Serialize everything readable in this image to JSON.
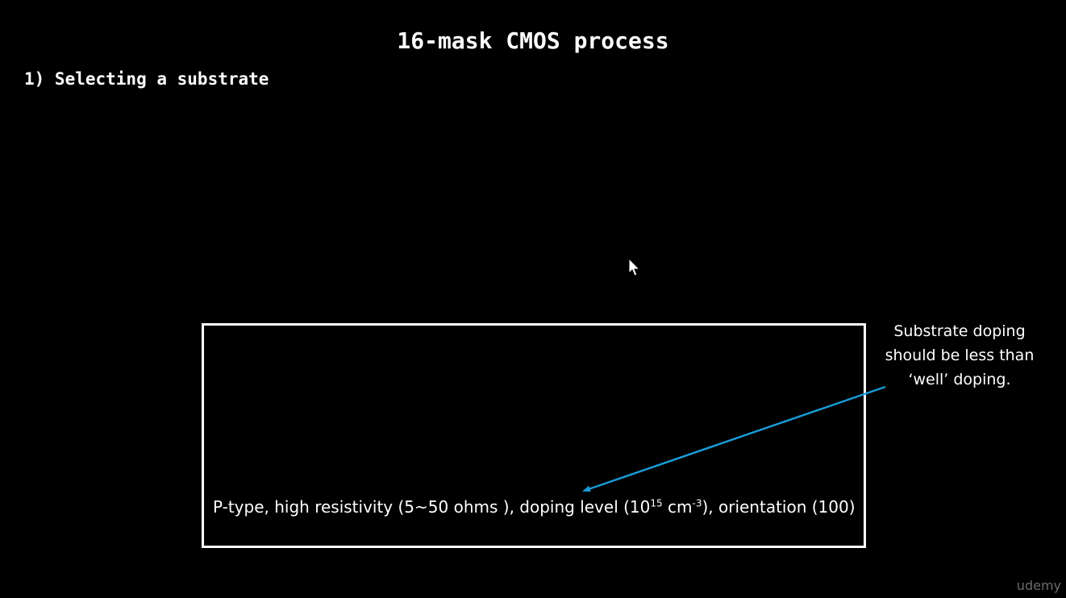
{
  "slide": {
    "title": "16-mask CMOS process",
    "step": "1) Selecting a substrate"
  },
  "substrate_box": {
    "spec_part1": "P-type, high resistivity (5~50 ohms ), doping level (10",
    "spec_exp1": "15",
    "spec_part2": " cm",
    "spec_exp2": "-3",
    "spec_part3": "), orientation (100)"
  },
  "annotation": {
    "line1": "Substrate doping",
    "line2": "should be less than",
    "line3": "‘well’ doping.",
    "arrow_color": "#1a9ad6"
  },
  "cursor": {
    "icon": "mouse-pointer-icon"
  },
  "watermark": {
    "brand": "udemy",
    "color": "#6b6b6b"
  }
}
